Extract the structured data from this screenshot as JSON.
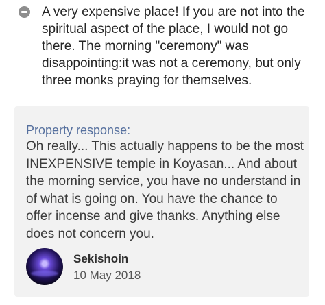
{
  "review": {
    "icon": "minus-circle-icon",
    "lines": [
      "A very expensive place! If you are not into the",
      "spiritual aspect of the place, I would not go",
      "there. The morning \"ceremony\" was",
      "disappointing:it was not a ceremony, but only",
      "three monks praying for themselves."
    ]
  },
  "property_response": {
    "title": "Property response:",
    "lines": [
      "Oh really... This actually happens to be the most",
      "INEXPENSIVE temple in Koyasan... And about",
      "the morning service, you have no understand in",
      "of what is going on. You have the chance to",
      "offer incense and give thanks. Anything else",
      "does not concern you."
    ],
    "responder": {
      "name": "Sekishoin",
      "date": "10 May 2018"
    }
  },
  "colors": {
    "background": "#ffffff",
    "card_background": "#f2f2f2",
    "response_title": "#56709e",
    "text": "#262626",
    "icon": "#8e8e8e"
  }
}
